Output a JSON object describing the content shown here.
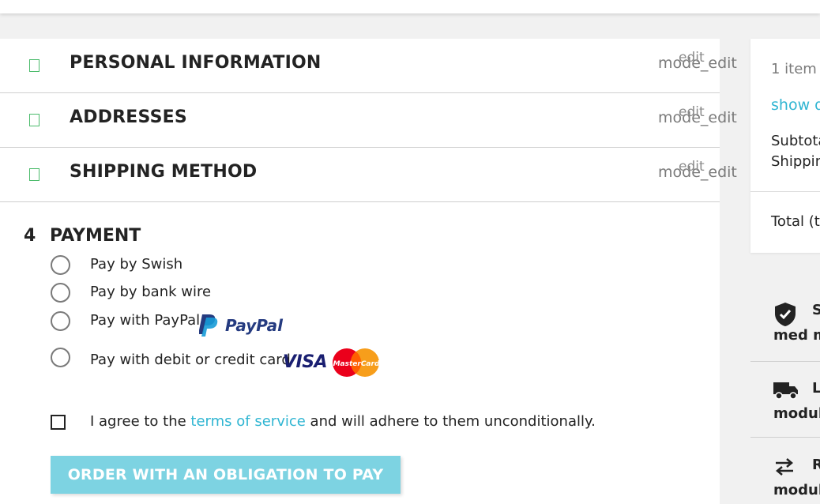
{
  "steps": [
    {
      "title": "PERSONAL INFORMATION",
      "edit_label": "mode_edit",
      "edit_overlay": "edit"
    },
    {
      "title": "ADDRESSES",
      "edit_label": "mode_edit",
      "edit_overlay": "edit"
    },
    {
      "title": "SHIPPING METHOD",
      "edit_label": "mode_edit",
      "edit_overlay": "edit"
    }
  ],
  "payment": {
    "number": "4",
    "title": "PAYMENT",
    "options": [
      {
        "label": "Pay by Swish"
      },
      {
        "label": "Pay by bank wire"
      },
      {
        "label": "Pay with PayPal",
        "logo": "PayPal"
      },
      {
        "label": "Pay with debit or credit card",
        "logos": [
          "VISA",
          "MasterCard"
        ]
      }
    ],
    "agree": {
      "before": "I agree to the ",
      "link": "terms of service",
      "after": " and will adhere to them unconditionally."
    },
    "order_button": "ORDER WITH AN OBLIGATION TO PAY"
  },
  "summary": {
    "item_count": "1 item",
    "show_details": "show d",
    "subtotal_label": "Subtota",
    "shipping_label": "Shippin",
    "total_label": "Total (ta"
  },
  "reassurance": [
    {
      "icon": "shield-check-icon",
      "line1": "S",
      "line2": "med m"
    },
    {
      "icon": "truck-icon",
      "line1": "L",
      "line2": "modul"
    },
    {
      "icon": "arrows-exchange-icon",
      "line1": "R",
      "line2": "modul"
    }
  ],
  "colors": {
    "accent": "#2fb5d2",
    "button": "#7dd3e2",
    "check": "#4cbb6c",
    "paypal_dark": "#253b80",
    "paypal_light": "#179bd7",
    "visa": "#1a1f71",
    "mc_red": "#eb001b",
    "mc_orange": "#f79e1b"
  }
}
